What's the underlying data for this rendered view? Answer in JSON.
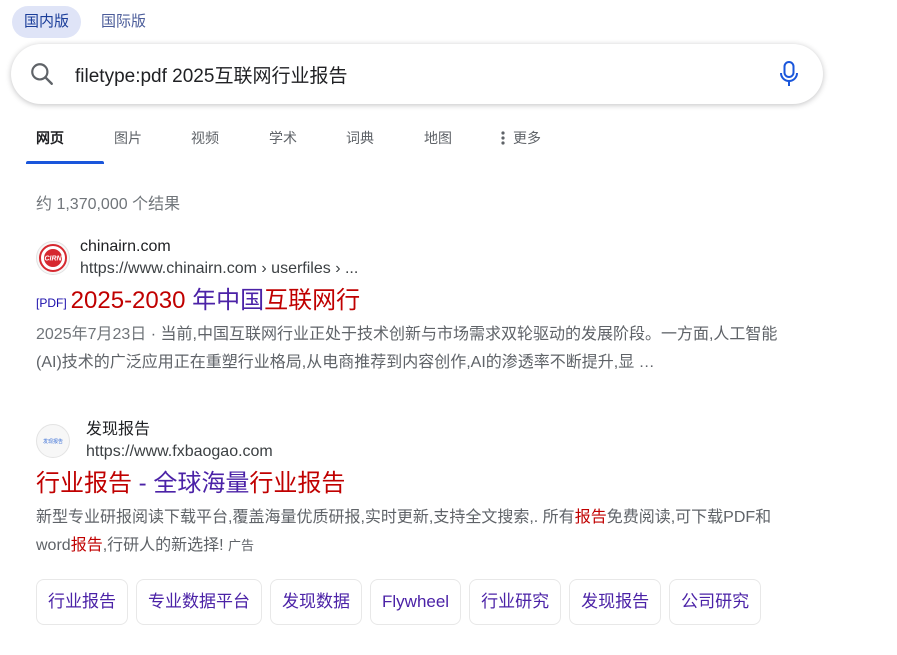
{
  "region_tabs": [
    {
      "label": "国内版",
      "active": true
    },
    {
      "label": "国际版",
      "active": false
    }
  ],
  "search": {
    "query": "filetype:pdf 2025互联网行业报告",
    "icon": "search-icon",
    "mic_icon": "microphone-icon"
  },
  "nav": {
    "items": [
      {
        "label": "网页",
        "active": true
      },
      {
        "label": "图片"
      },
      {
        "label": "视频"
      },
      {
        "label": "学术"
      },
      {
        "label": "词典"
      },
      {
        "label": "地图"
      },
      {
        "label": "更多",
        "icon": "more-vertical-icon"
      }
    ]
  },
  "result_count": "约 1,370,000 个结果",
  "results": [
    {
      "favicon_text": "CIRN",
      "site_name": "chinairn.com",
      "url": "https://www.chinairn.com › userfiles › ...",
      "badge": "[PDF]",
      "title_hl": "2025-2030",
      "title_rest": " 年中国",
      "title_hl2": "互联网行",
      "date": "2025年7月23日",
      "separator": " · ",
      "snippet": "当前,中国互联网行业正处于技术创新与市场需求双轮驱动的发展阶段。一方面,人工智能(AI)技术的广泛应用正在重塑行业格局,从电商推荐到内容创作,AI的渗透率不断提升,显 …"
    },
    {
      "favicon_text": "发现报告",
      "site_name": "发现报告",
      "url": "https://www.fxbaogao.com",
      "title_hl": "行业报告",
      "title_rest": " - 全球海量",
      "title_hl2": "行业报告",
      "snippet_a": "新型专业研报阅读下载平台,覆盖海量优质研报,实时更新,支持全文搜索,. 所有",
      "snippet_hl": "报告",
      "snippet_b": "免费阅读,可下载PDF和word",
      "snippet_hl2": "报告",
      "snippet_c": ",行研人的新选择! ",
      "ad_label": "广告"
    }
  ],
  "chips": [
    "行业报告",
    "专业数据平台",
    "发现数据",
    "Flywheel",
    "行业研究",
    "发现报告",
    "公司研究"
  ],
  "colors": {
    "accent": "#1a56db",
    "title_red": "#c00000",
    "title_purple": "#4b22a7"
  }
}
